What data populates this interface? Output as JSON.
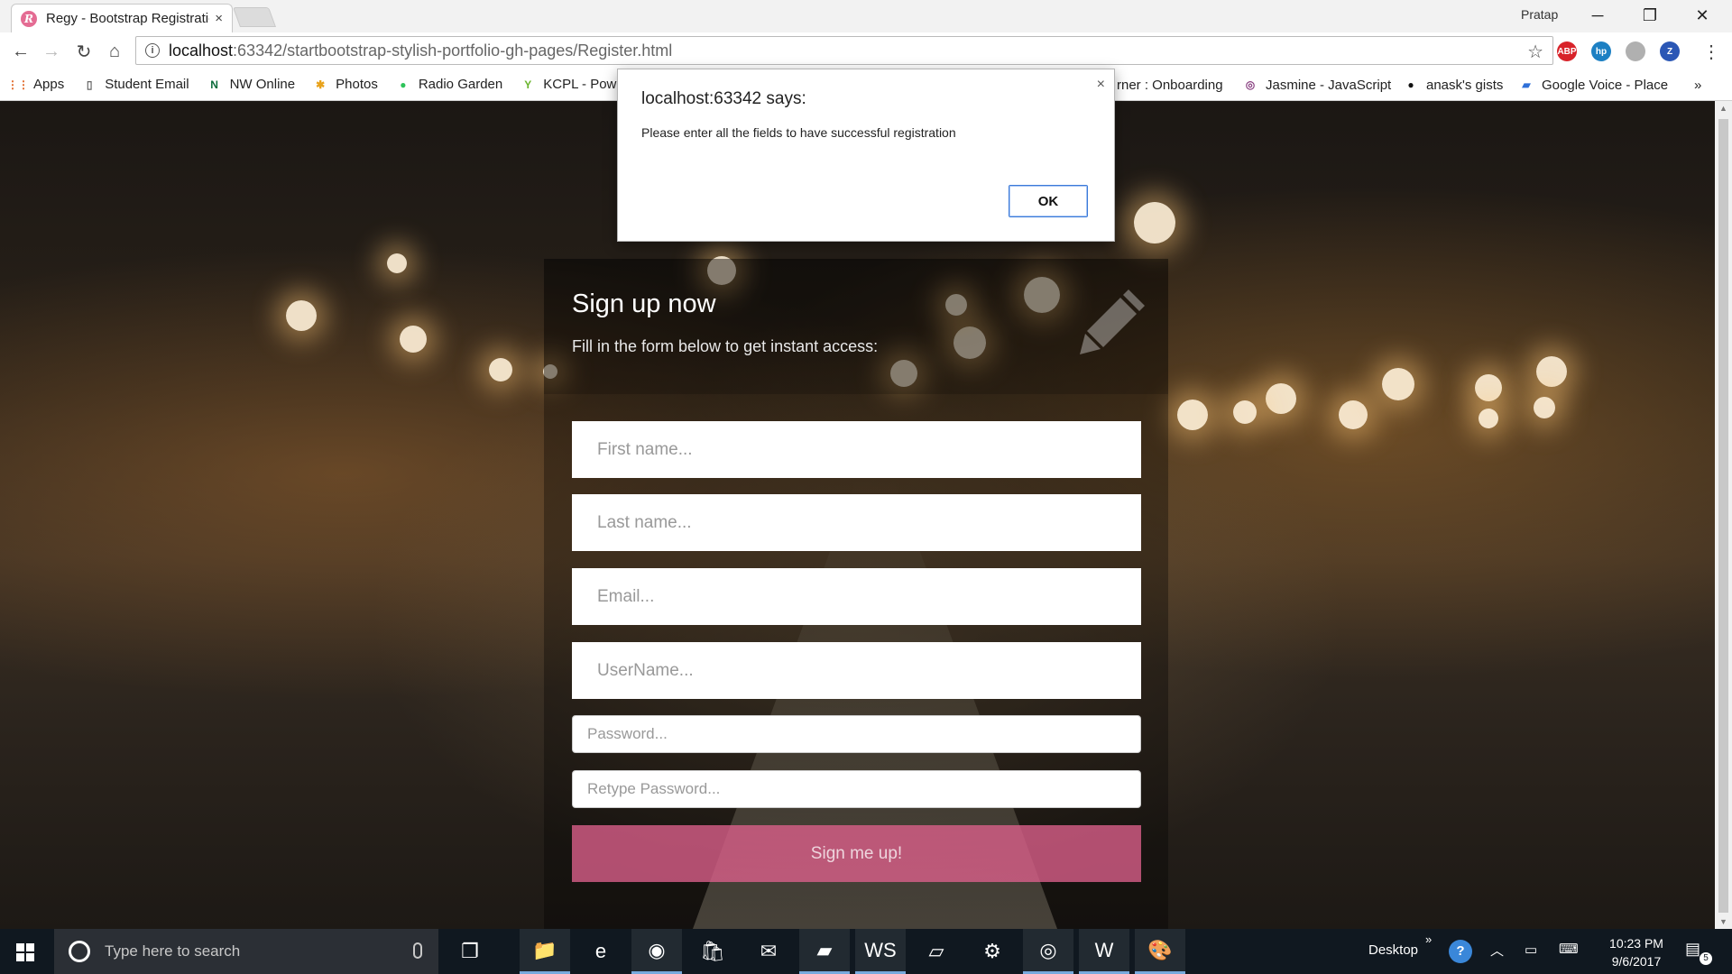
{
  "browser": {
    "tab": {
      "favicon_letter": "R",
      "title": "Regy - Bootstrap Registration",
      "close": "×"
    },
    "profile": "Pratap",
    "window_controls": {
      "minimize": "─",
      "restore": "❐",
      "close": "✕"
    },
    "nav": {
      "back": "←",
      "forward": "→",
      "reload": "↻",
      "home": "⌂"
    },
    "url": {
      "host": "localhost",
      "path": ":63342/startbootstrap-stylish-portfolio-gh-pages/Register.html"
    },
    "star": "☆",
    "extensions": [
      {
        "name": "adblock-plus-icon",
        "label": "ABP",
        "color": "#d8232a"
      },
      {
        "name": "hp-icon",
        "label": "hp",
        "color": "#1d80c3"
      },
      {
        "name": "extension-icon",
        "label": "",
        "color": "#b0b0b0"
      },
      {
        "name": "zotero-icon",
        "label": "Z",
        "color": "#2b57b5"
      }
    ],
    "menu": "⋮",
    "bookmarks": [
      {
        "name": "bookmark-apps",
        "label": "Apps",
        "icon": "⋮⋮",
        "color": "#e0601c"
      },
      {
        "name": "bookmark-student-email",
        "label": "Student Email",
        "icon": "▯",
        "color": "#666666"
      },
      {
        "name": "bookmark-nw-online",
        "label": "NW Online",
        "icon": "N",
        "color": "#0a6b3a"
      },
      {
        "name": "bookmark-photos",
        "label": "Photos",
        "icon": "✱",
        "color": "#e8a21b"
      },
      {
        "name": "bookmark-radio-garden",
        "label": "Radio Garden",
        "icon": "●",
        "color": "#2ec35a"
      },
      {
        "name": "bookmark-kcpl",
        "label": "KCPL - Powe",
        "icon": "Y",
        "color": "#6ab42d"
      }
    ],
    "bookmarks_right": [
      {
        "name": "bookmark-onboarding",
        "label": "rner : Onboarding",
        "icon": "",
        "color": "#666666"
      },
      {
        "name": "bookmark-jasmine",
        "label": "Jasmine - JavaScript",
        "icon": "◎",
        "color": "#8a4182"
      },
      {
        "name": "bookmark-gists",
        "label": "anask's gists",
        "icon": "●",
        "color": "#111111"
      },
      {
        "name": "bookmark-google-voice",
        "label": "Google Voice - Place",
        "icon": "▰",
        "color": "#2f70d8"
      }
    ],
    "bookmarks_more": "»"
  },
  "page": {
    "title": "Sign up now",
    "subtitle": "Fill in the form below to get instant access:",
    "fields": {
      "first_name": "First name...",
      "last_name": "Last name...",
      "email": "Email...",
      "username": "UserName...",
      "password": "Password...",
      "retype_password": "Retype Password..."
    },
    "submit": "Sign me up!"
  },
  "dialog": {
    "title": "localhost:63342 says:",
    "message": "Please enter all the fields to have successful registration",
    "ok": "OK",
    "close": "×"
  },
  "taskbar": {
    "search_placeholder": "Type here to search",
    "apps": [
      {
        "name": "task-view-icon",
        "glyph": "❐",
        "active": false
      },
      {
        "name": "file-explorer-icon",
        "glyph": "📁",
        "active": true
      },
      {
        "name": "edge-icon",
        "glyph": "e",
        "active": false
      },
      {
        "name": "chrome-icon",
        "glyph": "◉",
        "active": true
      },
      {
        "name": "store-icon",
        "glyph": "🛍",
        "active": false
      },
      {
        "name": "mail-icon",
        "glyph": "✉",
        "active": false
      },
      {
        "name": "sticky-notes-icon",
        "glyph": "▰",
        "active": true
      },
      {
        "name": "webstorm-icon",
        "glyph": "WS",
        "active": true
      },
      {
        "name": "notepad-icon",
        "glyph": "▱",
        "active": false
      },
      {
        "name": "settings-icon",
        "glyph": "⚙",
        "active": false
      },
      {
        "name": "app-icon",
        "glyph": "◎",
        "active": true
      },
      {
        "name": "word-icon",
        "glyph": "W",
        "active": true
      },
      {
        "name": "paint-icon",
        "glyph": "🎨",
        "active": true
      }
    ],
    "desktop_label": "Desktop",
    "chevron": "»",
    "time": "10:23 PM",
    "date": "9/6/2017",
    "notifications": "5"
  }
}
